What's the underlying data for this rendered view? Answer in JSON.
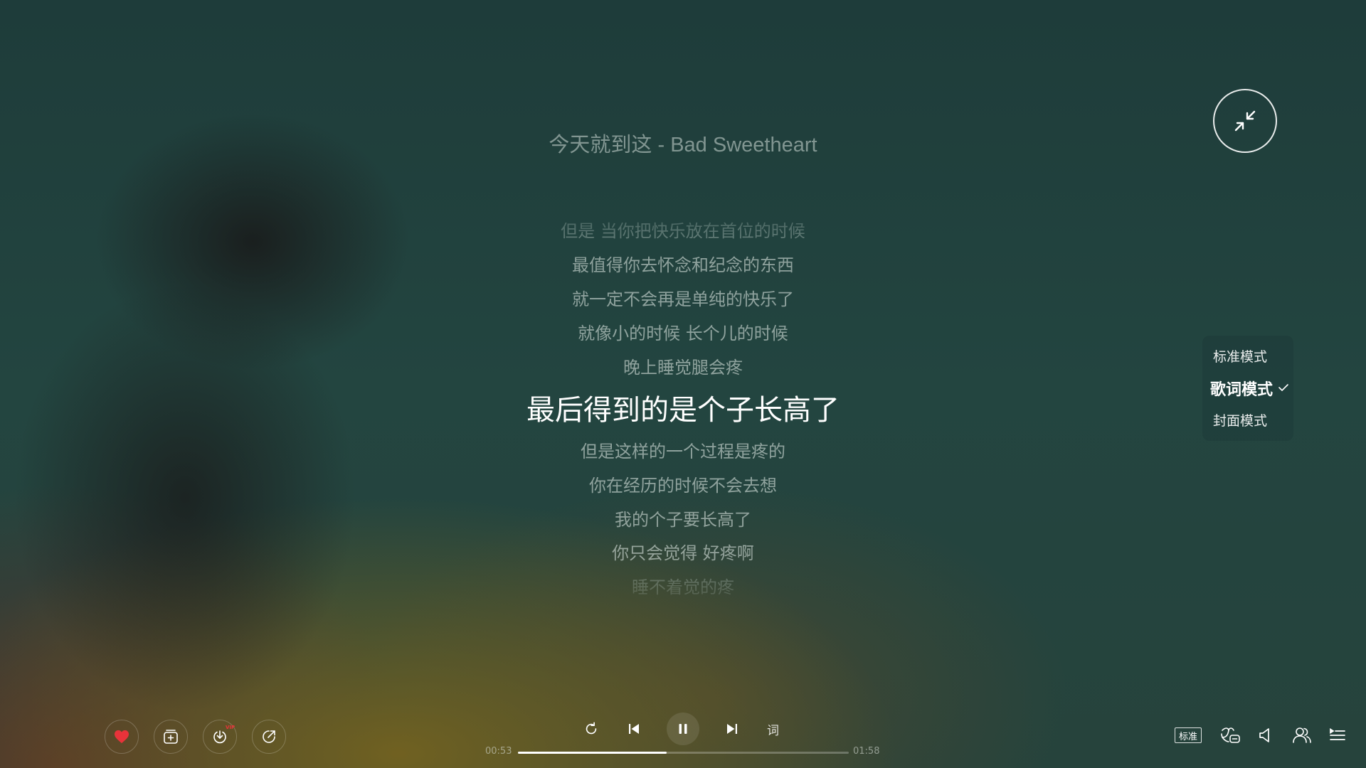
{
  "player": {
    "song_title": "今天就到这 - Bad Sweetheart",
    "lyrics": [
      "但是 当你把快乐放在首位的时候",
      "最值得你去怀念和纪念的东西",
      "就一定不会再是单纯的快乐了",
      "就像小的时候 长个儿的时候",
      "晚上睡觉腿会疼",
      "最后得到的是个子长高了",
      "但是这样的一个过程是疼的",
      "你在经历的时候不会去想",
      "我的个子要长高了",
      "你只会觉得 好疼啊",
      "睡不着觉的疼"
    ],
    "current_lyric_index": 5,
    "elapsed": "00:53",
    "duration": "01:58",
    "progress_fraction": 0.45,
    "is_playing": true,
    "liked": true,
    "lyric_toggle_label": "词",
    "vip_badge": "VIP",
    "quality_label": "标准"
  },
  "mode_menu": {
    "items": [
      {
        "label": "标准模式",
        "active": false
      },
      {
        "label": "歌词模式",
        "active": true
      },
      {
        "label": "封面模式",
        "active": false
      }
    ]
  },
  "icons": {
    "left_controls": [
      "heart-icon",
      "add-to-playlist-icon",
      "download-icon",
      "share-icon"
    ],
    "center_controls": [
      "repeat-icon",
      "previous-icon",
      "pause-icon",
      "next-icon"
    ],
    "right_controls": [
      "quality-badge",
      "effects-icon",
      "volume-icon",
      "listen-together-icon",
      "playlist-icon"
    ]
  },
  "colors": {
    "like": "#e8333a",
    "text_primary": "#ffffff",
    "vip": "#e8333a"
  }
}
